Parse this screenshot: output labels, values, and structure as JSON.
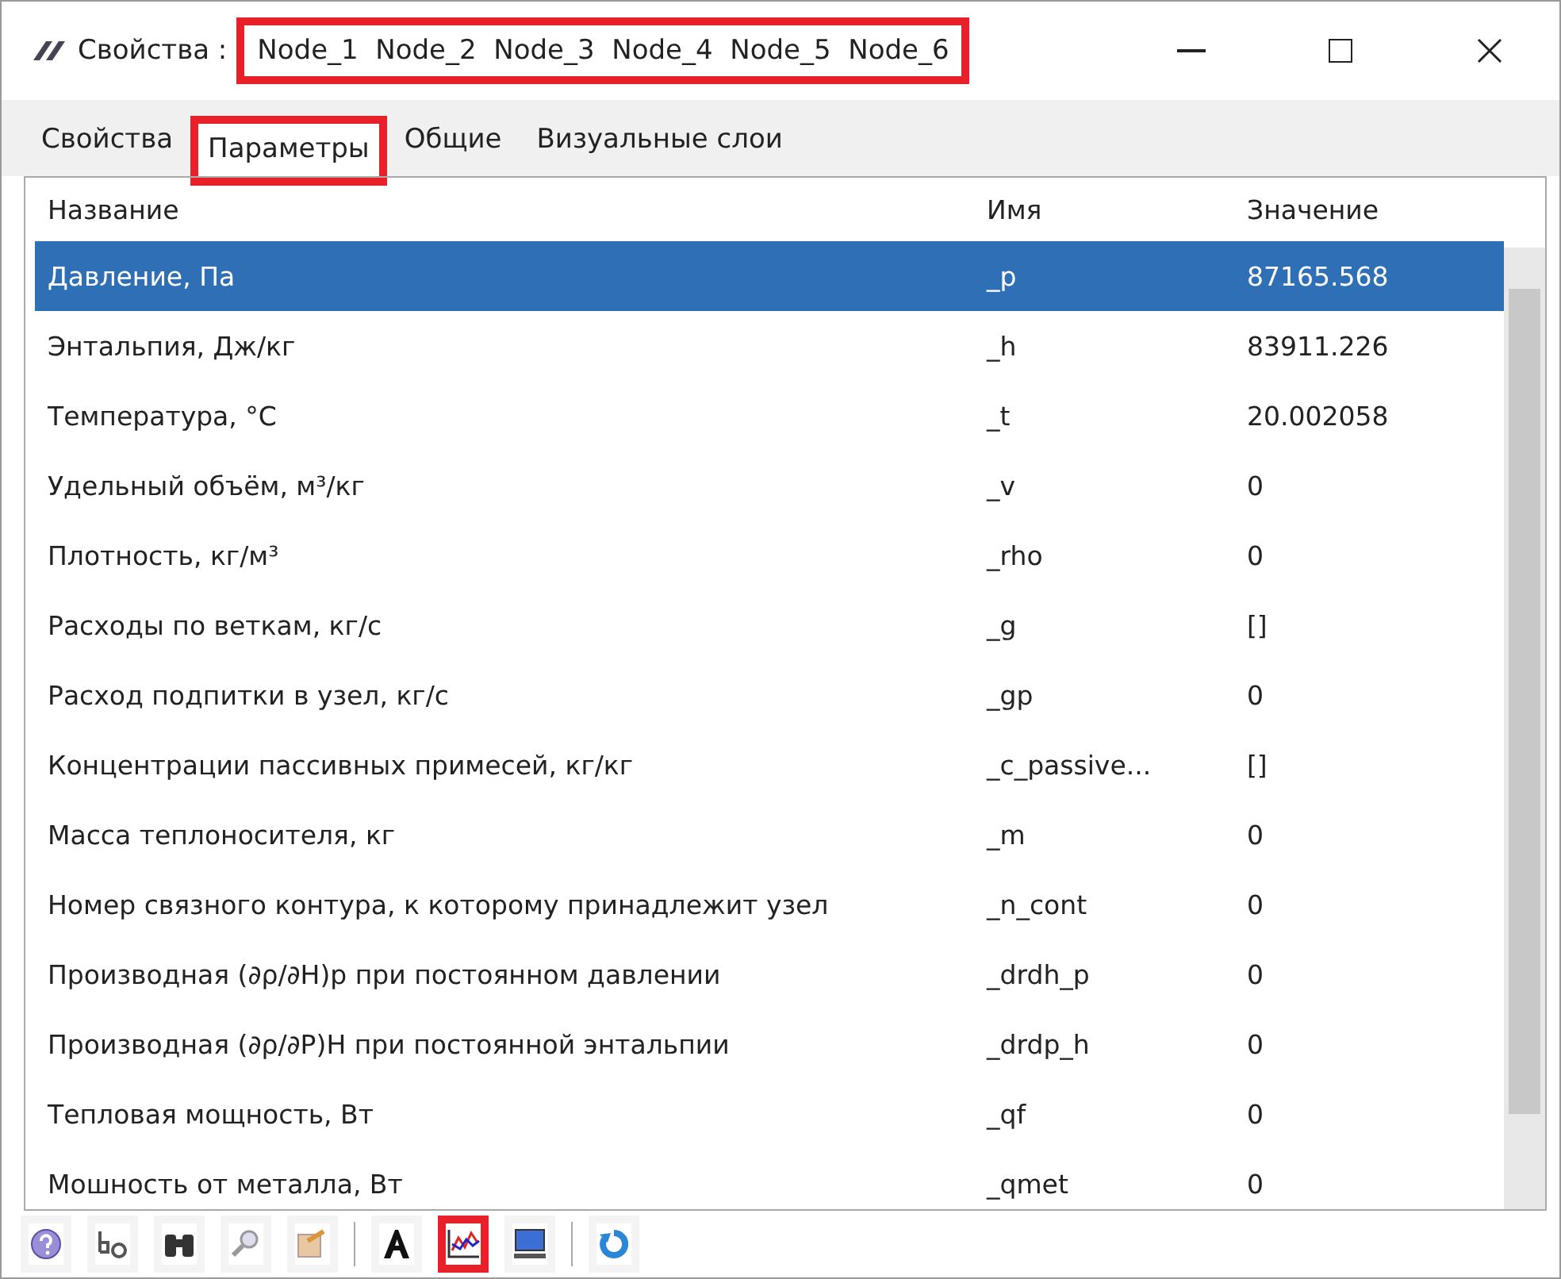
{
  "window": {
    "title": "Свойства :",
    "subtitle": "Node_1  Node_2  Node_3  Node_4  Node_5  Node_6",
    "subtitle_highlighted": true
  },
  "tabs": [
    {
      "label": "Свойства",
      "selected": false,
      "highlighted": false
    },
    {
      "label": "Параметры",
      "selected": true,
      "highlighted": true
    },
    {
      "label": "Общие",
      "selected": false,
      "highlighted": false
    },
    {
      "label": "Визуальные слои",
      "selected": false,
      "highlighted": false
    }
  ],
  "table": {
    "columns": [
      "Название",
      "Имя",
      "Значение"
    ],
    "rows": [
      {
        "cells": [
          "Давление, Па",
          "_p",
          "87165.568"
        ],
        "selected": true
      },
      {
        "cells": [
          "Энтальпия, Дж/кг",
          "_h",
          "83911.226"
        ],
        "selected": false
      },
      {
        "cells": [
          "Температура, °С",
          "_t",
          "20.002058"
        ],
        "selected": false
      },
      {
        "cells": [
          "Удельный объём, м³/кг",
          "_v",
          "0"
        ],
        "selected": false
      },
      {
        "cells": [
          "Плотность, кг/м³",
          "_rho",
          "0"
        ],
        "selected": false
      },
      {
        "cells": [
          "Расходы по веткам, кг/с",
          "_g",
          "[]"
        ],
        "selected": false
      },
      {
        "cells": [
          "Расход подпитки в узел, кг/с",
          "_gp",
          "0"
        ],
        "selected": false
      },
      {
        "cells": [
          "Концентрации пассивных примесей, кг/кг",
          "_c_passive...",
          "[]"
        ],
        "selected": false
      },
      {
        "cells": [
          "Масса теплоносителя, кг",
          "_m",
          "0"
        ],
        "selected": false
      },
      {
        "cells": [
          "Номер связного контура, к которому принадлежит узел",
          "_n_cont",
          "0"
        ],
        "selected": false
      },
      {
        "cells": [
          "Производная (∂ρ/∂H)p при постоянном давлении",
          "_drdh_p",
          "0"
        ],
        "selected": false
      },
      {
        "cells": [
          "Производная (∂ρ/∂P)H при постоянной энтальпии",
          "_drdp_h",
          "0"
        ],
        "selected": false
      },
      {
        "cells": [
          "Тепловая мощность, Вт",
          "_qf",
          "0"
        ],
        "selected": false
      },
      {
        "cells": [
          "Мошность от металла, Вт",
          "_qmet",
          "0"
        ],
        "selected": false
      }
    ]
  },
  "toolbar": [
    {
      "kind": "help",
      "highlighted": false
    },
    {
      "kind": "case",
      "highlighted": false
    },
    {
      "kind": "binoculars",
      "highlighted": false
    },
    {
      "kind": "magnifier",
      "highlighted": false
    },
    {
      "kind": "export",
      "highlighted": false
    },
    {
      "kind": "separator"
    },
    {
      "kind": "font",
      "highlighted": false
    },
    {
      "kind": "chart",
      "highlighted": true
    },
    {
      "kind": "monitor",
      "highlighted": false
    },
    {
      "kind": "separator"
    },
    {
      "kind": "refresh",
      "highlighted": false
    }
  ]
}
